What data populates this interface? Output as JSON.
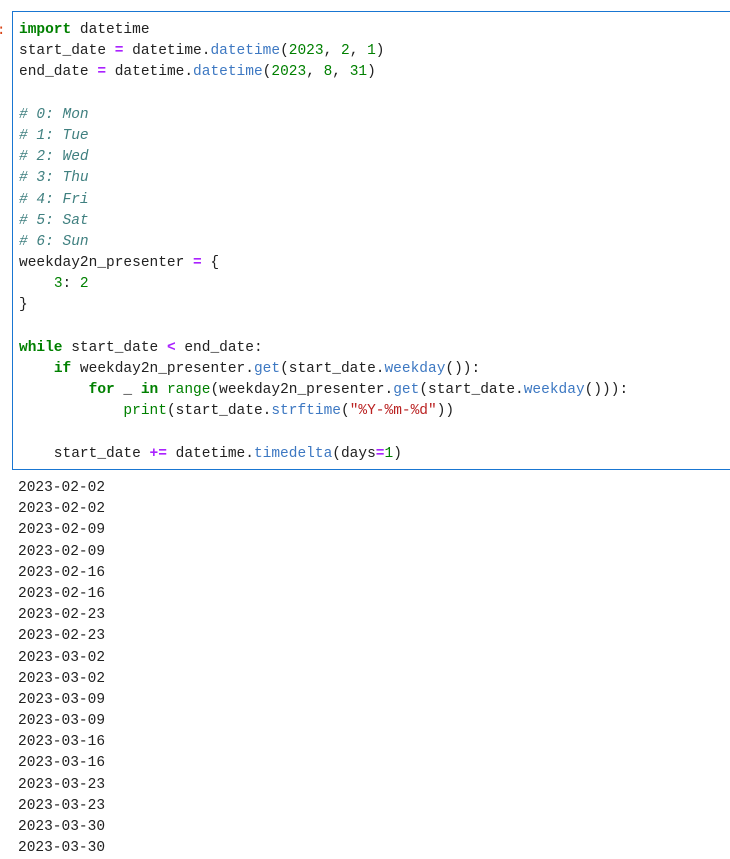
{
  "cell": {
    "prompt": ":",
    "code_lines": [
      [
        {
          "t": "import",
          "c": "kw"
        },
        {
          "t": " datetime",
          "c": ""
        }
      ],
      [
        {
          "t": "start_date ",
          "c": ""
        },
        {
          "t": "=",
          "c": "op"
        },
        {
          "t": " datetime.",
          "c": ""
        },
        {
          "t": "datetime",
          "c": "call"
        },
        {
          "t": "(",
          "c": ""
        },
        {
          "t": "2023",
          "c": "num"
        },
        {
          "t": ", ",
          "c": ""
        },
        {
          "t": "2",
          "c": "num"
        },
        {
          "t": ", ",
          "c": ""
        },
        {
          "t": "1",
          "c": "num"
        },
        {
          "t": ")",
          "c": ""
        }
      ],
      [
        {
          "t": "end_date ",
          "c": ""
        },
        {
          "t": "=",
          "c": "op"
        },
        {
          "t": " datetime.",
          "c": ""
        },
        {
          "t": "datetime",
          "c": "call"
        },
        {
          "t": "(",
          "c": ""
        },
        {
          "t": "2023",
          "c": "num"
        },
        {
          "t": ", ",
          "c": ""
        },
        {
          "t": "8",
          "c": "num"
        },
        {
          "t": ", ",
          "c": ""
        },
        {
          "t": "31",
          "c": "num"
        },
        {
          "t": ")",
          "c": ""
        }
      ],
      [],
      [
        {
          "t": "# 0: Mon",
          "c": "cm"
        }
      ],
      [
        {
          "t": "# 1: Tue",
          "c": "cm"
        }
      ],
      [
        {
          "t": "# 2: Wed",
          "c": "cm"
        }
      ],
      [
        {
          "t": "# 3: Thu",
          "c": "cm"
        }
      ],
      [
        {
          "t": "# 4: Fri",
          "c": "cm"
        }
      ],
      [
        {
          "t": "# 5: Sat",
          "c": "cm"
        }
      ],
      [
        {
          "t": "# 6: Sun",
          "c": "cm"
        }
      ],
      [
        {
          "t": "weekday2n_presenter ",
          "c": ""
        },
        {
          "t": "=",
          "c": "op"
        },
        {
          "t": " {",
          "c": ""
        }
      ],
      [
        {
          "t": "    ",
          "c": ""
        },
        {
          "t": "3",
          "c": "num"
        },
        {
          "t": ": ",
          "c": ""
        },
        {
          "t": "2",
          "c": "num"
        }
      ],
      [
        {
          "t": "}",
          "c": ""
        }
      ],
      [],
      [
        {
          "t": "while",
          "c": "kw"
        },
        {
          "t": " start_date ",
          "c": ""
        },
        {
          "t": "<",
          "c": "op"
        },
        {
          "t": " end_date:",
          "c": ""
        }
      ],
      [
        {
          "t": "    ",
          "c": ""
        },
        {
          "t": "if",
          "c": "kw"
        },
        {
          "t": " weekday2n_presenter.",
          "c": ""
        },
        {
          "t": "get",
          "c": "call"
        },
        {
          "t": "(start_date.",
          "c": ""
        },
        {
          "t": "weekday",
          "c": "call"
        },
        {
          "t": "()):",
          "c": ""
        }
      ],
      [
        {
          "t": "        ",
          "c": ""
        },
        {
          "t": "for",
          "c": "kw"
        },
        {
          "t": " _ ",
          "c": ""
        },
        {
          "t": "in",
          "c": "kw"
        },
        {
          "t": " ",
          "c": ""
        },
        {
          "t": "range",
          "c": "builtin"
        },
        {
          "t": "(weekday2n_presenter.",
          "c": ""
        },
        {
          "t": "get",
          "c": "call"
        },
        {
          "t": "(start_date.",
          "c": ""
        },
        {
          "t": "weekday",
          "c": "call"
        },
        {
          "t": "())):",
          "c": ""
        }
      ],
      [
        {
          "t": "            ",
          "c": ""
        },
        {
          "t": "print",
          "c": "builtin"
        },
        {
          "t": "(start_date.",
          "c": ""
        },
        {
          "t": "strftime",
          "c": "call"
        },
        {
          "t": "(",
          "c": ""
        },
        {
          "t": "\"%Y-%m-%d\"",
          "c": "str"
        },
        {
          "t": "))",
          "c": ""
        }
      ],
      [],
      [
        {
          "t": "    start_date ",
          "c": ""
        },
        {
          "t": "+=",
          "c": "op"
        },
        {
          "t": " datetime.",
          "c": ""
        },
        {
          "t": "timedelta",
          "c": "call"
        },
        {
          "t": "(days",
          "c": ""
        },
        {
          "t": "=",
          "c": "op"
        },
        {
          "t": "1",
          "c": "num"
        },
        {
          "t": ")",
          "c": ""
        }
      ]
    ]
  },
  "output": {
    "lines": [
      "2023-02-02",
      "2023-02-02",
      "2023-02-09",
      "2023-02-09",
      "2023-02-16",
      "2023-02-16",
      "2023-02-23",
      "2023-02-23",
      "2023-03-02",
      "2023-03-02",
      "2023-03-09",
      "2023-03-09",
      "2023-03-16",
      "2023-03-16",
      "2023-03-23",
      "2023-03-23",
      "2023-03-30",
      "2023-03-30"
    ]
  },
  "colors": {
    "cell_border": "#1976d2",
    "keyword": "#008000",
    "operator": "#aa22ff",
    "number": "#008000",
    "method": "#3d78c2",
    "string": "#ba2121",
    "comment": "#408080"
  }
}
